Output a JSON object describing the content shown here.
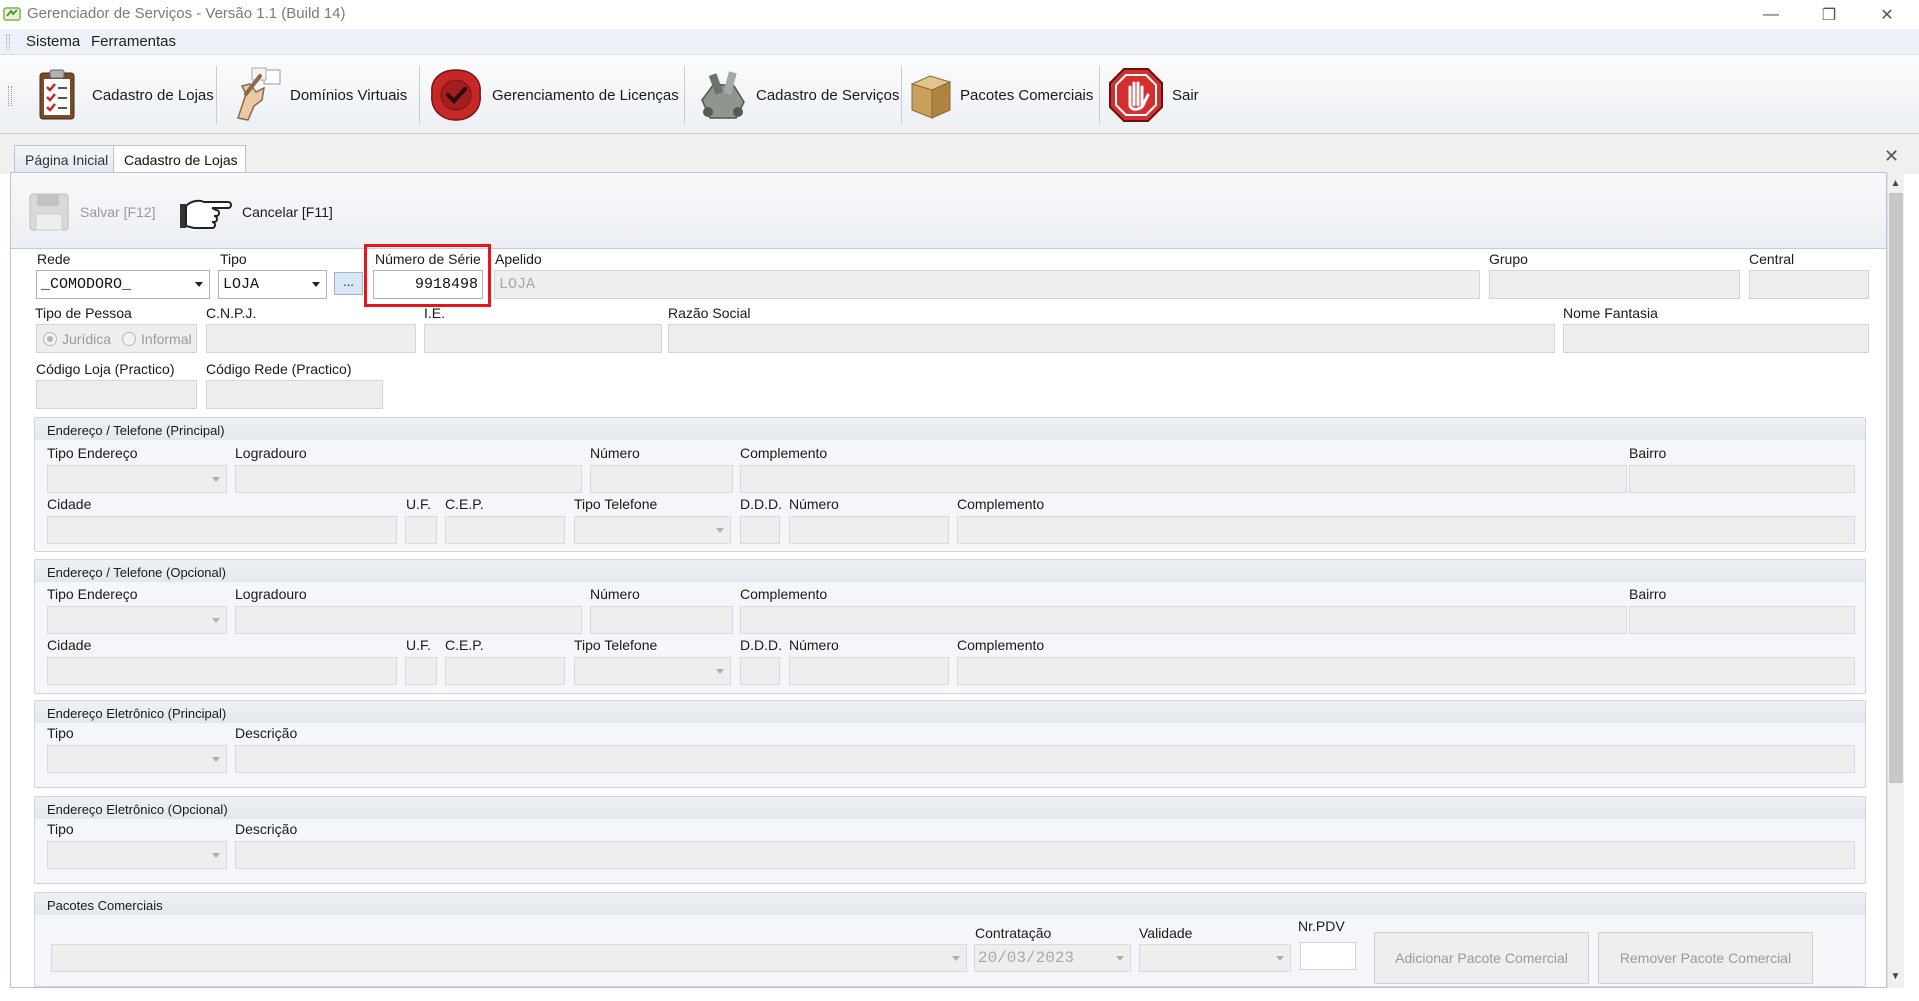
{
  "window": {
    "title": "Gerenciador de Serviços - Versão 1.1 (Build 14)",
    "minimize": "—",
    "restore": "❐",
    "close": "✕"
  },
  "menu": {
    "items": [
      "Sistema",
      "Ferramentas"
    ]
  },
  "toolbar": {
    "buttons": [
      {
        "label": "Cadastro de Lojas",
        "icon": "clipboard-checklist-icon"
      },
      {
        "label": "Domínios Virtuais",
        "icon": "pointing-hand-icon"
      },
      {
        "label": "Gerenciamento de Licenças",
        "icon": "wax-seal-icon"
      },
      {
        "label": "Cadastro de Serviços",
        "icon": "toolbox-icon"
      },
      {
        "label": "Pacotes Comerciais",
        "icon": "cardboard-box-icon"
      },
      {
        "label": "Sair",
        "icon": "stop-hand-icon"
      }
    ]
  },
  "tabs": [
    {
      "label": "Página Inicial",
      "active": false
    },
    {
      "label": "Cadastro de Lojas",
      "active": true
    }
  ],
  "tab_close": "✕",
  "form_toolbar": {
    "save": "Salvar [F12]",
    "cancel": "Cancelar [F11]"
  },
  "form": {
    "rede": {
      "label": "Rede",
      "value": "_COMODORO_"
    },
    "tipo": {
      "label": "Tipo",
      "value": "LOJA"
    },
    "ellipsis": "...",
    "numero_serie": {
      "label": "Número de Série",
      "value": "9918498"
    },
    "apelido": {
      "label": "Apelido",
      "value": "LOJA"
    },
    "grupo": {
      "label": "Grupo"
    },
    "central": {
      "label": "Central"
    },
    "tipo_pessoa": {
      "label": "Tipo de Pessoa",
      "options": [
        "Jurídica",
        "Informal"
      ]
    },
    "cnpj": {
      "label": "C.N.P.J."
    },
    "ie": {
      "label": "I.E."
    },
    "razao_social": {
      "label": "Razão Social"
    },
    "nome_fantasia": {
      "label": "Nome Fantasia"
    },
    "codigo_loja": {
      "label": "Código Loja (Practico)"
    },
    "codigo_rede": {
      "label": "Código Rede (Practico)"
    }
  },
  "groups": {
    "endereco_principal": "Endereço / Telefone (Principal)",
    "endereco_opcional": "Endereço / Telefone (Opcional)",
    "eletronico_principal": "Endereço Eletrônico (Principal)",
    "eletronico_opcional": "Endereço Eletrônico (Opcional)",
    "pacotes": "Pacotes Comerciais"
  },
  "address_labels": {
    "tipo_endereco": "Tipo Endereço",
    "logradouro": "Logradouro",
    "numero": "Número",
    "complemento": "Complemento",
    "bairro": "Bairro",
    "cidade": "Cidade",
    "uf": "U.F.",
    "cep": "C.E.P.",
    "tipo_telefone": "Tipo Telefone",
    "ddd": "D.D.D.",
    "numero_tel": "Número",
    "complemento_tel": "Complemento"
  },
  "email_labels": {
    "tipo": "Tipo",
    "descricao": "Descrição"
  },
  "pacotes": {
    "contratacao": {
      "label": "Contratação",
      "value": "20/03/2023"
    },
    "validade": {
      "label": "Validade"
    },
    "nr_pdv": {
      "label": "Nr.PDV"
    },
    "add_button": "Adicionar Pacote Comercial",
    "remove_button": "Remover Pacote Comercial"
  }
}
